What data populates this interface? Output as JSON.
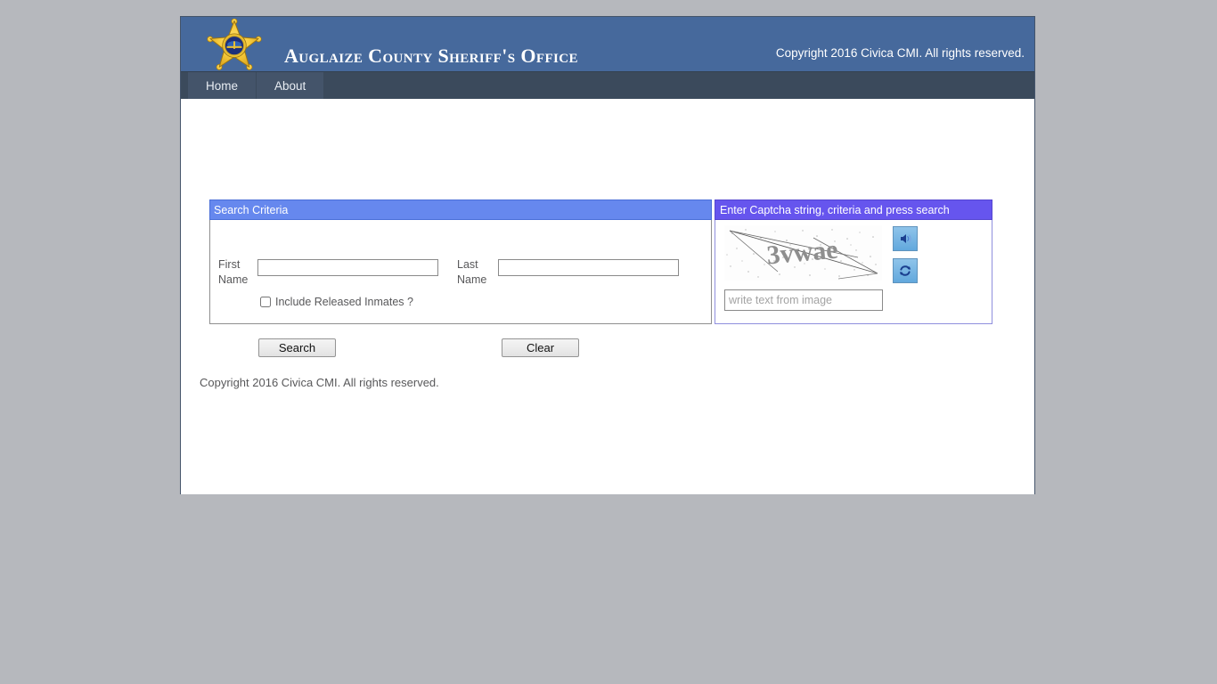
{
  "header": {
    "badge_icon": "sheriff-star-badge",
    "site_title": "Auglaize County Sheriff's Office",
    "copyright": "Copyright 2016 Civica CMI. All rights reserved.",
    "bg_color": "#46699c"
  },
  "nav": {
    "items": [
      {
        "label": "Home"
      },
      {
        "label": "About"
      }
    ],
    "bg_color": "#3b4a5c"
  },
  "search_panel": {
    "title": "Search Criteria",
    "header_color": "#6688ee",
    "first_name": {
      "label": "First Name",
      "value": "",
      "placeholder": ""
    },
    "last_name": {
      "label": "Last Name",
      "value": "",
      "placeholder": ""
    },
    "include_released": {
      "label": "Include Released Inmates ?",
      "checked": false
    },
    "search_button": "Search",
    "clear_button": "Clear"
  },
  "captcha_panel": {
    "title": "Enter Captcha string, criteria and press search",
    "header_color": "#6655ee",
    "captcha_text": "3vwae",
    "audio_button_icon": "speaker-icon",
    "refresh_button_icon": "refresh-icon",
    "input": {
      "value": "",
      "placeholder": "write text from image"
    }
  },
  "footer": {
    "copyright": "Copyright 2016 Civica CMI. All rights reserved."
  }
}
